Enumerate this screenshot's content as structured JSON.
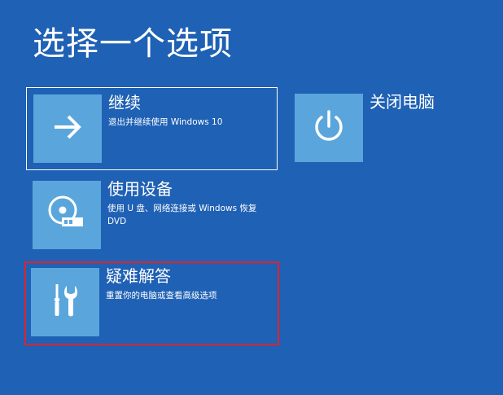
{
  "page": {
    "title": "选择一个选项"
  },
  "options": {
    "continue": {
      "label": "继续",
      "description": "退出并继续使用 Windows 10",
      "icon": "arrow-right-icon"
    },
    "use_device": {
      "label": "使用设备",
      "description": "使用 U 盘、网络连接或 Windows 恢复 DVD",
      "icon": "disc-usb-icon"
    },
    "troubleshoot": {
      "label": "疑难解答",
      "description": "重置你的电脑或查看高级选项",
      "icon": "tools-icon"
    },
    "shutdown": {
      "label": "关闭电脑",
      "icon": "power-icon"
    }
  },
  "colors": {
    "background": "#1f61b4",
    "tile": "#5aa6dc",
    "highlight_border": "#e0232a"
  }
}
